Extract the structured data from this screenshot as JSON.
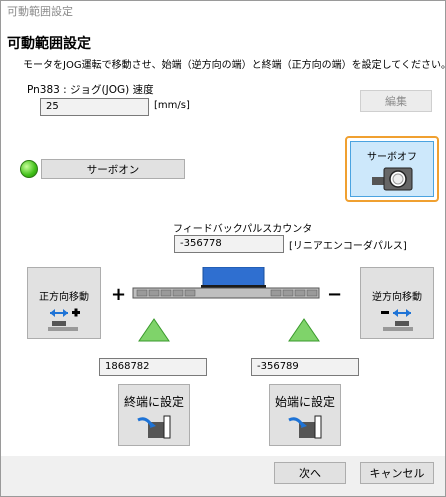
{
  "window": {
    "title": "可動範囲設定"
  },
  "heading": "可動範囲設定",
  "description": "モータをJOG運転で移動させ、始端（逆方向の端）と終端（正方向の端）を設定してください。",
  "jog_speed": {
    "label": "Pn383 : ジョグ(JOG) 速度",
    "value": "25",
    "unit": "[mm/s]"
  },
  "edit_button": "編集",
  "servo_on_button": "サーボオン",
  "servo_off_button": "サーボオフ",
  "feedback": {
    "label": "フィードバックパルスカウンタ",
    "value": "-356778",
    "unit": "[リニアエンコーダパルス]"
  },
  "forward_button": "正方向移動",
  "reverse_button": "逆方向移動",
  "end_position": {
    "value": "1868782",
    "button": "終端に設定"
  },
  "start_position": {
    "value": "-356789",
    "button": "始端に設定"
  },
  "plus_sign": "+",
  "minus_sign": "−",
  "next_button": "次へ",
  "cancel_button": "キャンセル",
  "colors": {
    "accent_orange": "#f0a030",
    "servo_lamp": "#3fbf17",
    "triangle_green": "#7fd36a",
    "slider_blue": "#2f6fd0"
  },
  "icons": [
    "servo-motor-icon",
    "move-forward-icon",
    "move-reverse-icon",
    "set-end-icon",
    "set-start-icon",
    "linear-stage-icon"
  ]
}
